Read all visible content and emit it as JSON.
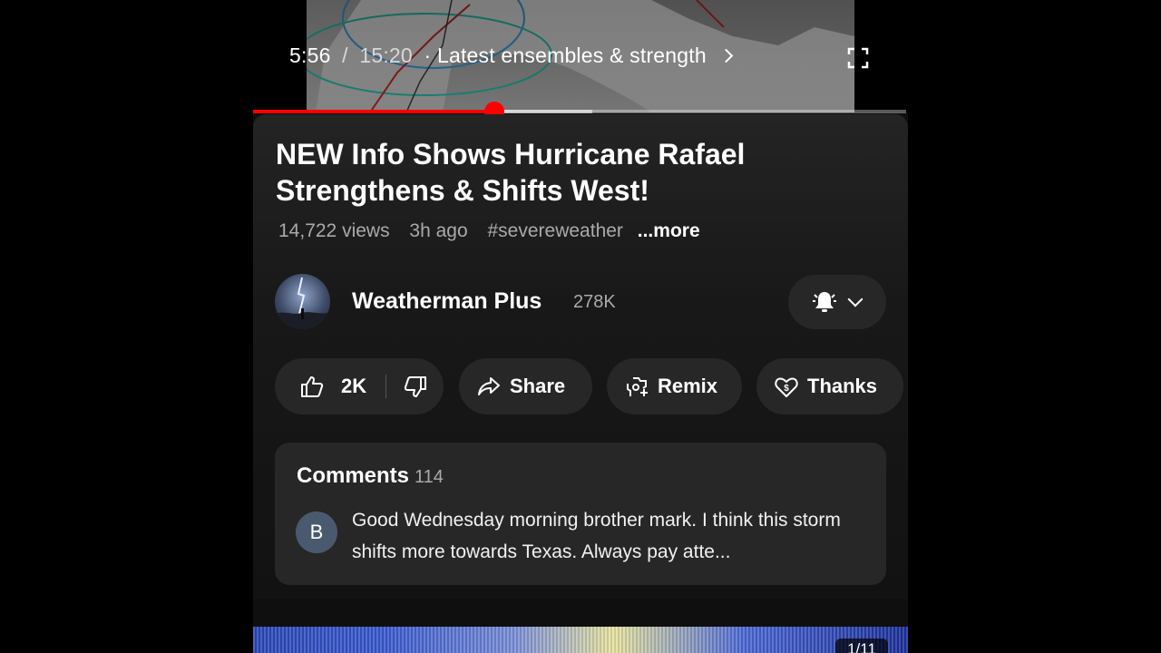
{
  "player": {
    "current_time": "5:56",
    "separator": "/",
    "total_time": "15:20",
    "chapter": "· Latest ensembles & strength",
    "progress_played_fraction": 0.37,
    "progress_buffered_fraction": 0.52
  },
  "video": {
    "title": "NEW Info Shows Hurricane Rafael Strengthens & Shifts West!",
    "views": "14,722 views",
    "age": "3h ago",
    "hashtag": "#severeweather",
    "more_label": "...more"
  },
  "channel": {
    "name": "Weatherman Plus",
    "subscribers": "278K"
  },
  "actions": {
    "likes": "2K",
    "share_label": "Share",
    "remix_label": "Remix",
    "thanks_label": "Thanks"
  },
  "comments": {
    "header": "Comments",
    "count": "114",
    "top_comment_avatar_letter": "B",
    "top_comment_text": "Good Wednesday morning brother mark. I think this storm shifts more towards Texas. Always pay atte..."
  },
  "next": {
    "badge": "1/11"
  },
  "colors": {
    "accent": "#ff0000",
    "background": "#0f0f0f",
    "pill": "#272727",
    "secondary_text": "#aaaaaa"
  },
  "icons": [
    "fullscreen-icon",
    "bell-icon",
    "chevron-down-icon",
    "thumbs-up-icon",
    "thumbs-down-icon",
    "share-icon",
    "remix-icon",
    "thanks-icon"
  ]
}
